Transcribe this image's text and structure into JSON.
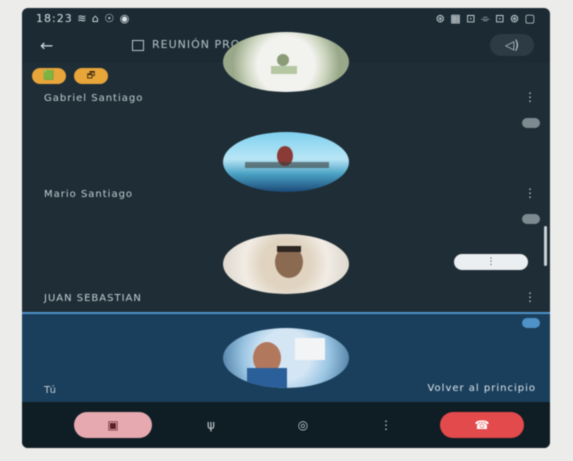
{
  "status_bar": {
    "time": "18:23 ≋ ⌂ ☉ ◉",
    "icons": "⊛ ▦ ⊡ ⌯ ⊡ ⊛ ▢"
  },
  "app_bar": {
    "title": "REUNIÓN PROGRAM",
    "back_icon": "arrow-left-icon",
    "calendar_icon": "calendar-icon",
    "speaker_icon": "speaker-icon"
  },
  "participants": [
    {
      "name": "Gabriel Santiago",
      "chips": [
        "🟩",
        "🗗"
      ]
    },
    {
      "name": "Mario Santiago"
    },
    {
      "name": "JUAN SEBASTIAN",
      "pill": "⋮"
    },
    {
      "name": "Tú",
      "return_label": "Volver al principio"
    }
  ],
  "bottom_bar": {
    "camera_icon": "camera-icon",
    "mic_icon": "microphone-icon",
    "share_icon": "share-icon",
    "more_icon": "more-vert-icon",
    "hangup_icon": "phone-hangup-icon"
  },
  "colors": {
    "background": "#1b2a33",
    "self_tile": "#1a3f5c",
    "hangup": "#e34a4c",
    "camera_button": "#e6a9b0",
    "chip": "#e8a53a"
  }
}
